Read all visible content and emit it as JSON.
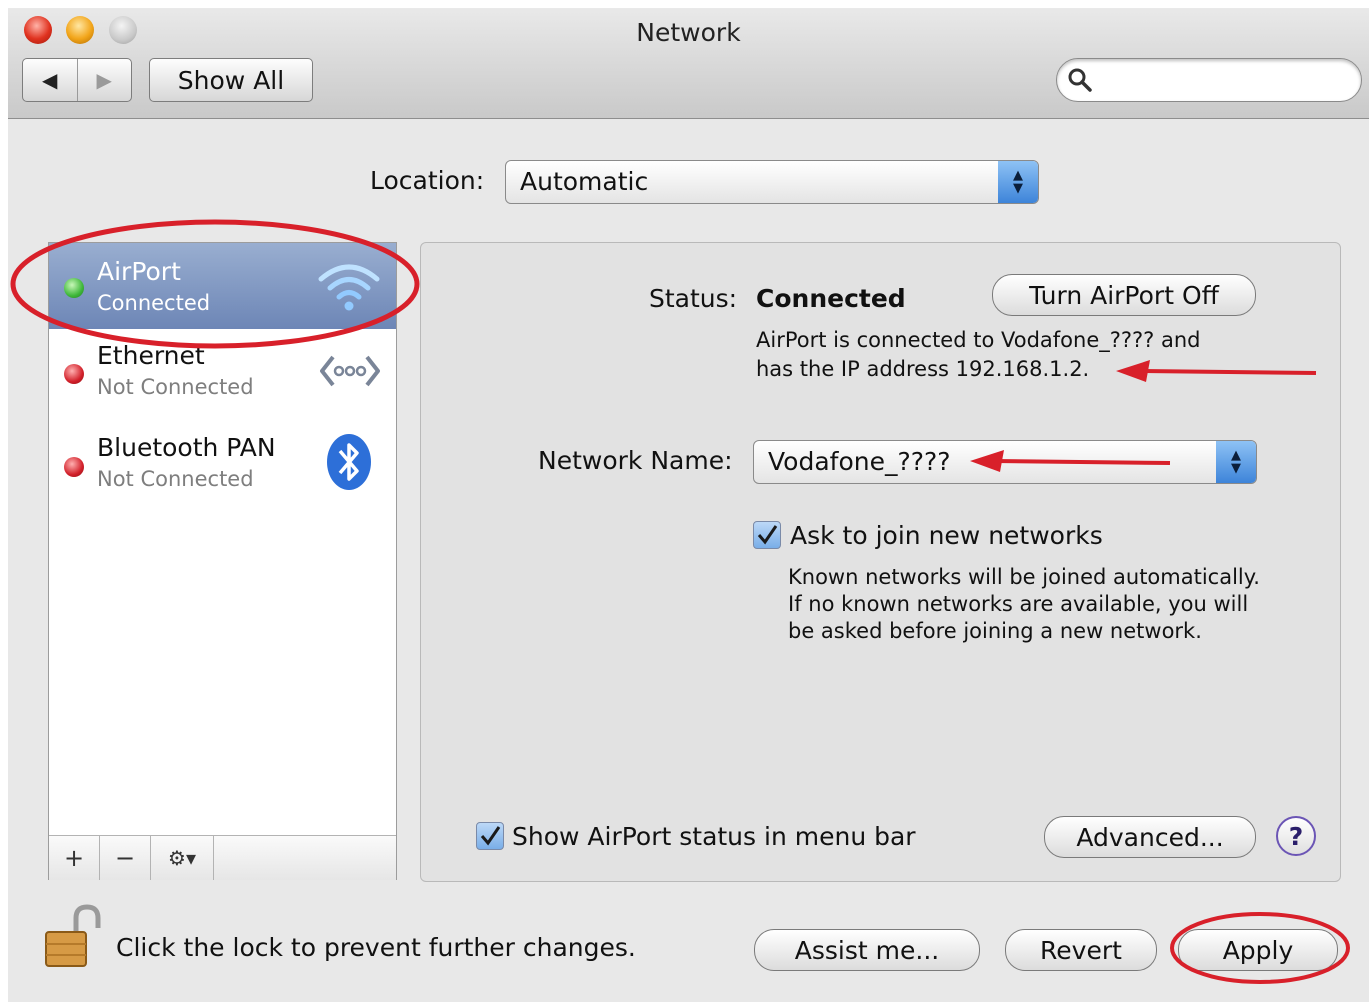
{
  "window": {
    "title": "Network"
  },
  "toolbar": {
    "back_glyph": "◀",
    "forward_glyph": "▶",
    "show_all_label": "Show All",
    "search_value": ""
  },
  "location": {
    "label": "Location:",
    "value": "Automatic"
  },
  "services": [
    {
      "name": "AirPort",
      "status": "Connected",
      "status_color": "#3fb83a",
      "icon": "wifi-icon",
      "selected": true
    },
    {
      "name": "Ethernet",
      "status": "Not Connected",
      "status_color": "#d2202a",
      "icon": "ethernet-icon",
      "selected": false
    },
    {
      "name": "Bluetooth PAN",
      "status": "Not Connected",
      "status_color": "#d2202a",
      "icon": "bluetooth-icon",
      "selected": false
    }
  ],
  "sidebar_controls": {
    "add": "+",
    "remove": "−",
    "action": "⚙▾"
  },
  "detail": {
    "status_label": "Status:",
    "status_value": "Connected",
    "turn_off_label": "Turn AirPort Off",
    "status_desc_line1": "AirPort is connected to Vodafone_???? and",
    "status_desc_line2": "has the IP address 192.168.1.2.",
    "network_name_label": "Network Name:",
    "network_name_value": "Vodafone_????",
    "ask_join_label": "Ask to join new networks",
    "ask_join_checked": true,
    "ask_join_desc_line1": "Known networks will be joined automatically.",
    "ask_join_desc_line2": "If no known networks are available, you will",
    "ask_join_desc_line3": "be asked before joining a new network.",
    "show_status_label": "Show AirPort status in menu bar",
    "show_status_checked": true,
    "advanced_label": "Advanced...",
    "help_label": "?"
  },
  "footer": {
    "lock_text": "Click the lock to prevent further changes.",
    "assist_label": "Assist me...",
    "revert_label": "Revert",
    "apply_label": "Apply"
  },
  "annotations": {
    "highlight_color": "#d8202a"
  }
}
